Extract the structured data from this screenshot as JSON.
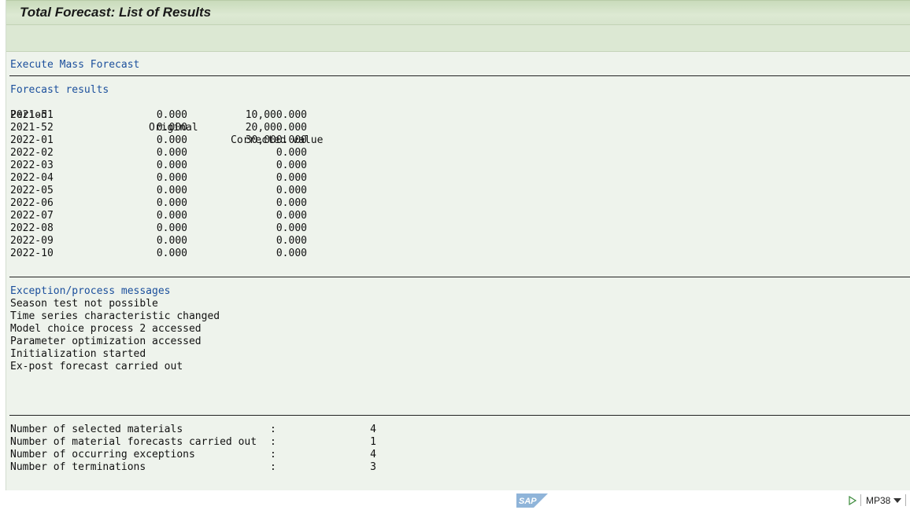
{
  "window": {
    "title": "Total Forecast: List of Results"
  },
  "report": {
    "section_execute": "Execute Mass Forecast",
    "forecast": {
      "heading": "Forecast results",
      "columns": {
        "period": "Period",
        "original": "Original",
        "corrected": "Corrected value"
      },
      "rows": [
        {
          "period": "2021-51",
          "original": "0.000",
          "corrected": "10,000.000"
        },
        {
          "period": "2021-52",
          "original": "0.000",
          "corrected": "20,000.000"
        },
        {
          "period": "2022-01",
          "original": "0.000",
          "corrected": "30,000.000"
        },
        {
          "period": "2022-02",
          "original": "0.000",
          "corrected": "0.000"
        },
        {
          "period": "2022-03",
          "original": "0.000",
          "corrected": "0.000"
        },
        {
          "period": "2022-04",
          "original": "0.000",
          "corrected": "0.000"
        },
        {
          "period": "2022-05",
          "original": "0.000",
          "corrected": "0.000"
        },
        {
          "period": "2022-06",
          "original": "0.000",
          "corrected": "0.000"
        },
        {
          "period": "2022-07",
          "original": "0.000",
          "corrected": "0.000"
        },
        {
          "period": "2022-08",
          "original": "0.000",
          "corrected": "0.000"
        },
        {
          "period": "2022-09",
          "original": "0.000",
          "corrected": "0.000"
        },
        {
          "period": "2022-10",
          "original": "0.000",
          "corrected": "0.000"
        }
      ]
    },
    "messages": {
      "heading": "Exception/process messages",
      "items": [
        "Season test not possible",
        "Time series characteristic changed",
        "Model choice process 2 accessed",
        "Parameter optimization accessed",
        "Initialization started",
        "Ex-post forecast carried out"
      ]
    },
    "statistics": [
      {
        "label": "Number of selected materials",
        "colon": ":",
        "value": "4"
      },
      {
        "label": "Number of material forecasts carried out",
        "colon": ":",
        "value": "1"
      },
      {
        "label": "Number of occurring exceptions",
        "colon": ":",
        "value": "4"
      },
      {
        "label": "Number of terminations",
        "colon": ":",
        "value": "3"
      }
    ]
  },
  "status_bar": {
    "logo_text": "SAP",
    "transaction_code": "MP38",
    "icons": {
      "run": "play-triangle-icon",
      "dropdown": "caret-down-icon"
    }
  },
  "colors": {
    "background": "#eef3ec",
    "title_bar": "#d6e4cc",
    "heading_blue": "#1b4f9c",
    "sap_logo": "#8fb4d9"
  }
}
